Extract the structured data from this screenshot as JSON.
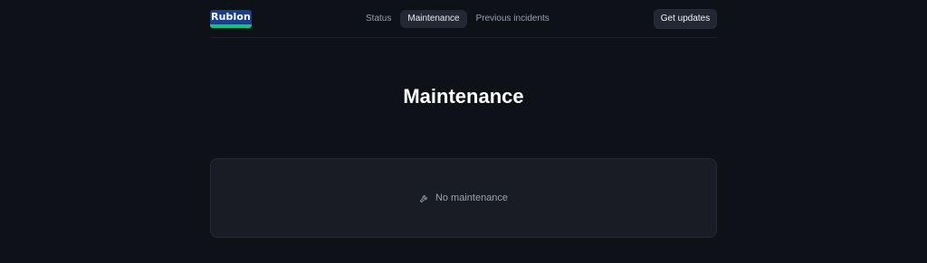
{
  "brand": {
    "name": "Rublon"
  },
  "nav": {
    "items": [
      {
        "label": "Status"
      },
      {
        "label": "Maintenance"
      },
      {
        "label": "Previous incidents"
      }
    ],
    "active": "Maintenance"
  },
  "header": {
    "cta_label": "Get updates"
  },
  "main": {
    "title": "Maintenance"
  },
  "maintenance_panel": {
    "empty_label": "No maintenance",
    "icon": "wrench-icon"
  },
  "colors": {
    "background": "#0f1119",
    "panel": "#191c25",
    "brand_blue": "#173f8a",
    "brand_green": "#14c27a"
  }
}
